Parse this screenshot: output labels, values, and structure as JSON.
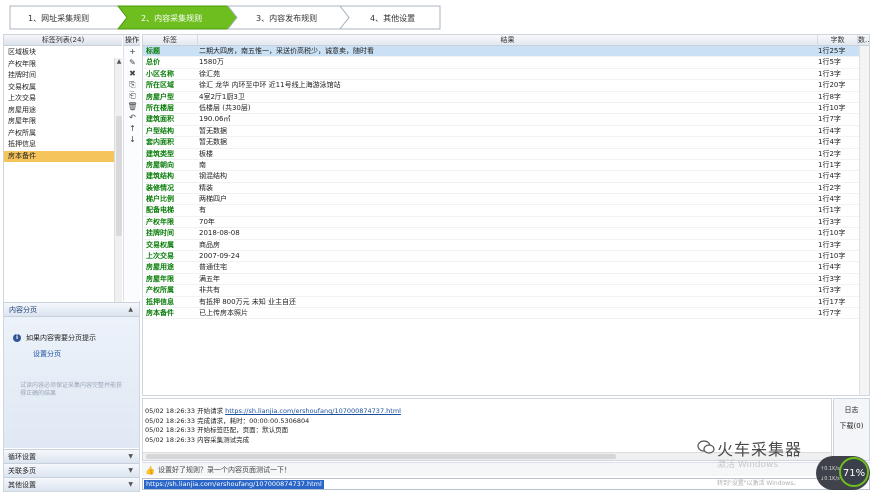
{
  "steps": [
    {
      "label": "1、网址采集规则"
    },
    {
      "label": "2、内容采集规则"
    },
    {
      "label": "3、内容发布规则"
    },
    {
      "label": "4、其他设置"
    }
  ],
  "left": {
    "list_header": "标签列表(24)",
    "ops_header": "操作",
    "tags": [
      "区域板块",
      "产权年限",
      "挂牌时间",
      "交易权属",
      "上次交易",
      "房屋用途",
      "房屋年限",
      "产权所属",
      "抵押信息",
      "房本备件"
    ],
    "selected_index": 9,
    "ops": {
      "add": "+",
      "edit": "✎",
      "delete": "✖",
      "copy": "⎘",
      "paste": "⎗",
      "clear": "🗑",
      "undo": "↶",
      "up": "↑",
      "down": "↓"
    },
    "content_section": {
      "title": "内容分页",
      "tip": "如果内容需要分页提示",
      "link": "设置分页",
      "hint": "试读内容必须保证采集内容完整并能获得正确的结果"
    },
    "collapsed": [
      "循环设置",
      "关联多页",
      "其他设置"
    ]
  },
  "grid": {
    "headers": {
      "label": "标签",
      "result": "结果",
      "count": "字数",
      "extra": "数..."
    },
    "rows": [
      {
        "label": "标题",
        "result": "二期大四房，南五惟一，采送价高税少，诚意卖，随时看",
        "count": "1行25字",
        "selected": true
      },
      {
        "label": "总价",
        "result": "1580万",
        "count": "1行5字"
      },
      {
        "label": "小区名称",
        "result": "徐汇苑",
        "count": "1行3字"
      },
      {
        "label": "所在区域",
        "result": "徐汇 龙华 内环至中环 近11号线上海游泳馆站",
        "count": "1行20字"
      },
      {
        "label": "房屋户型",
        "result": "4室2厅1厨3卫",
        "count": "1行8字"
      },
      {
        "label": "所在楼层",
        "result": "低楼层 (共30层)",
        "count": "1行10字"
      },
      {
        "label": "建筑面积",
        "result": "190.06㎡",
        "count": "1行7字"
      },
      {
        "label": "户型结构",
        "result": "暂无数据",
        "count": "1行4字"
      },
      {
        "label": "套内面积",
        "result": "暂无数据",
        "count": "1行4字"
      },
      {
        "label": "建筑类型",
        "result": "板楼",
        "count": "1行2字"
      },
      {
        "label": "房屋朝向",
        "result": "南",
        "count": "1行1字"
      },
      {
        "label": "建筑结构",
        "result": "钢混结构",
        "count": "1行4字"
      },
      {
        "label": "装修情况",
        "result": "精装",
        "count": "1行2字"
      },
      {
        "label": "梯户比例",
        "result": "两梯四户",
        "count": "1行4字"
      },
      {
        "label": "配备电梯",
        "result": "有",
        "count": "1行1字"
      },
      {
        "label": "产权年限",
        "result": "70年",
        "count": "1行3字"
      },
      {
        "label": "挂牌时间",
        "result": "2018-08-08",
        "count": "1行10字"
      },
      {
        "label": "交易权属",
        "result": "商品房",
        "count": "1行3字"
      },
      {
        "label": "上次交易",
        "result": "2007-09-24",
        "count": "1行10字"
      },
      {
        "label": "房屋用途",
        "result": "普通住宅",
        "count": "1行4字"
      },
      {
        "label": "房屋年限",
        "result": "满五年",
        "count": "1行3字"
      },
      {
        "label": "产权所属",
        "result": "非共有",
        "count": "1行3字"
      },
      {
        "label": "抵押信息",
        "result": "有抵押 800万元 未知 业主自还",
        "count": "1行17字"
      },
      {
        "label": "房本备件",
        "result": "已上传房本照片",
        "count": "1行7字"
      }
    ]
  },
  "log": {
    "lines": [
      {
        "time": "05/02 18:26:33",
        "msg": "开始请求",
        "url": "https://sh.lianjia.com/ershoufang/107000874737.html"
      },
      {
        "time": "05/02 18:26:33",
        "msg": "完成请求，耗时：00:00:00.5306804",
        "url": ""
      },
      {
        "time": "05/02 18:26:33",
        "msg": "开始标签匹配，页面：默认页面",
        "url": ""
      },
      {
        "time": "05/02 18:26:33",
        "msg": "内容采集测试完成",
        "url": ""
      }
    ],
    "tabs": [
      "日志",
      "下载(0)"
    ]
  },
  "feedback": "设置好了规则？录一个内容页面测试一下！",
  "url_bar": "https://sh.lianjia.com/ershoufang/107000874737.html",
  "watermark": "火车采集器",
  "activate": "激活 Windows",
  "activate_hint": "转到\"设置\"以激活 Windows。",
  "speed": {
    "percent": "71",
    "up": "0.1K/s",
    "down": "0.1K/s"
  },
  "colors": {
    "active_step": "#6dbe1e",
    "label_green": "#0a7d0a",
    "selected_tag": "#f5c45a",
    "selected_row": "#c9e0f5",
    "url_highlight": "#2a66c7"
  }
}
